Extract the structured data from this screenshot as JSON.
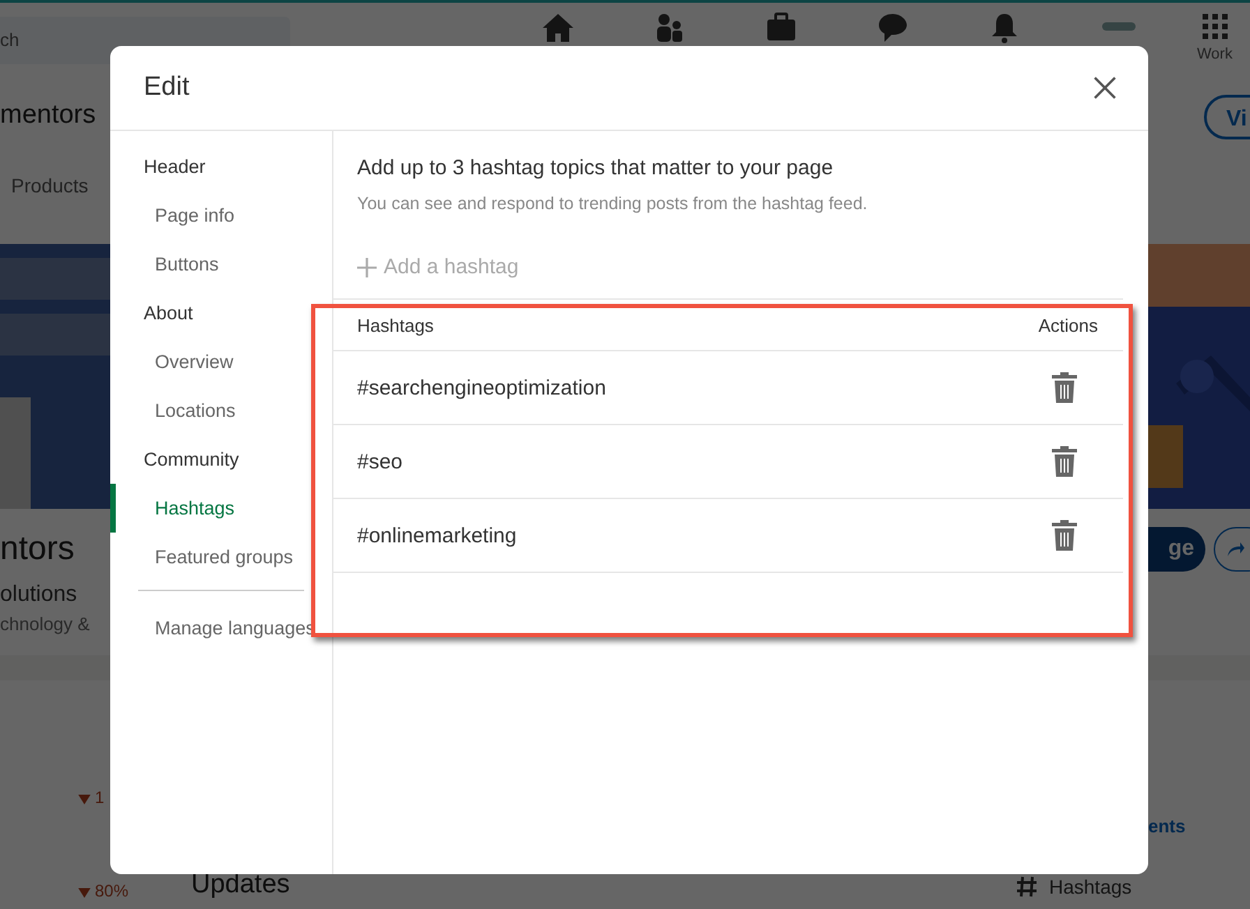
{
  "background_page": {
    "search_placeholder": "ch",
    "work_label": "Work",
    "company_name_top": "mentors",
    "view_button": "Vi",
    "tab": "Products",
    "company_name": "ntors",
    "tagline": "olutions",
    "industry": "chnology &",
    "follow_button": "ge",
    "stats": [
      "1",
      "80%"
    ],
    "updates_heading": "Updates",
    "comments_link": "ents",
    "hashtags_link": "Hashtags"
  },
  "dialog": {
    "title": "Edit",
    "nav_sections": [
      {
        "heading": "Header",
        "items": [
          {
            "label": "Page info",
            "selected": false
          },
          {
            "label": "Buttons",
            "selected": false
          }
        ]
      },
      {
        "heading": "About",
        "items": [
          {
            "label": "Overview",
            "selected": false
          },
          {
            "label": "Locations",
            "selected": false
          }
        ]
      },
      {
        "heading": "Community",
        "items": [
          {
            "label": "Hashtags",
            "selected": true
          },
          {
            "label": "Featured groups",
            "selected": false
          }
        ]
      }
    ],
    "nav_footer": [
      "Manage languages"
    ],
    "heading": "Add up to 3 hashtag topics that matter to your page",
    "subheading": "You can see and respond to trending posts from the hashtag feed.",
    "add_button": "Add a hashtag",
    "table": {
      "columns": [
        "Hashtags",
        "Actions"
      ],
      "rows": [
        {
          "hashtag": "#searchengineoptimization"
        },
        {
          "hashtag": "#seo"
        },
        {
          "hashtag": "#onlinemarketing"
        }
      ]
    }
  }
}
